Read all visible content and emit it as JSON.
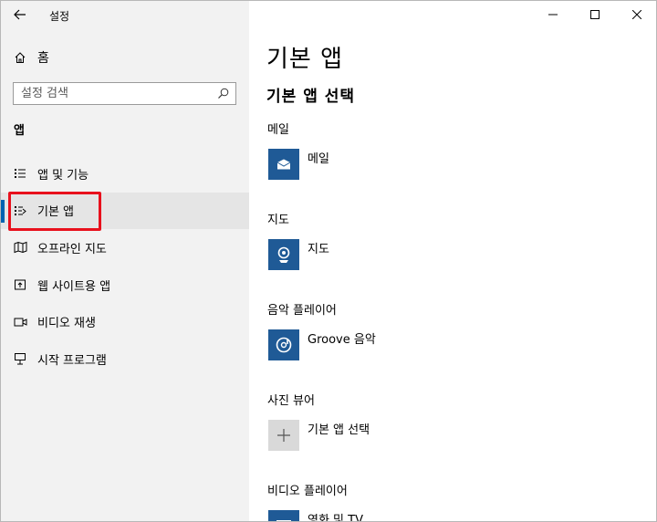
{
  "window": {
    "title": "설정"
  },
  "sidebar": {
    "home_label": "홈",
    "search_placeholder": "설정 검색",
    "section_label": "앱",
    "items": [
      {
        "label": "앱 및 기능",
        "icon": "list-icon"
      },
      {
        "label": "기본 앱",
        "icon": "default-apps-icon",
        "selected": true
      },
      {
        "label": "오프라인 지도",
        "icon": "offline-map-icon"
      },
      {
        "label": "웹 사이트용 앱",
        "icon": "web-app-icon"
      },
      {
        "label": "비디오 재생",
        "icon": "video-icon"
      },
      {
        "label": "시작 프로그램",
        "icon": "startup-icon"
      }
    ],
    "highlight_color": "#e8101c",
    "accent_color": "#0063b1"
  },
  "main": {
    "title": "기본 앱",
    "subtitle": "기본 앱 선택",
    "categories": [
      {
        "label": "메일",
        "app": "메일",
        "icon": "mail-icon"
      },
      {
        "label": "지도",
        "app": "지도",
        "icon": "maps-icon"
      },
      {
        "label": "음악 플레이어",
        "app": "Groove 음악",
        "icon": "groove-music-icon"
      },
      {
        "label": "사진 뷰어",
        "app": "기본 앱 선택",
        "icon": "plus-icon"
      },
      {
        "label": "비디오 플레이어",
        "app": "영화 및 TV",
        "icon": "movies-tv-icon"
      }
    ]
  }
}
